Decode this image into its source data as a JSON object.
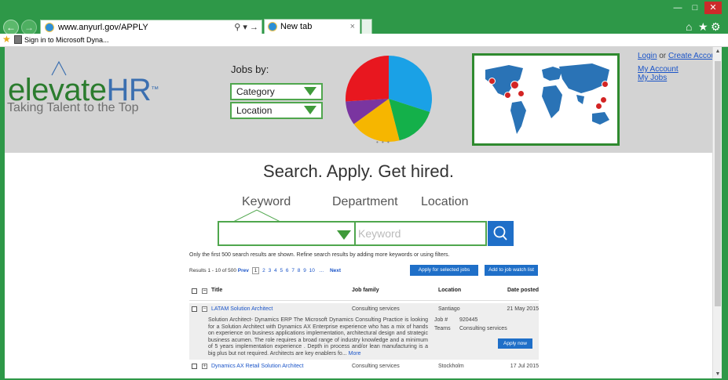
{
  "browser": {
    "url": "www.anyurl.gov/APPLY",
    "tab_title": "New tab",
    "favorite_label": "Sign in to Microsoft Dyna..."
  },
  "header": {
    "logo_word_main": "elevate",
    "logo_word_hr": "HR",
    "logo_tm": "™",
    "logo_tagline": "Taking Talent to the Top",
    "jobs_by_label": "Jobs by:",
    "category_select": "Category",
    "location_select": "Location",
    "account": {
      "login": "Login",
      "or": "or",
      "create_account": "Create Account",
      "my_account": "My Account",
      "my_jobs": "My Jobs"
    },
    "pie_slices": [
      {
        "color": "#1aa1e6",
        "value": 30
      },
      {
        "color": "#14b04a",
        "value": 16
      },
      {
        "color": "#f6b600",
        "value": 19
      },
      {
        "color": "#7a35a0",
        "value": 9
      },
      {
        "color": "#e8171f",
        "value": 26
      }
    ]
  },
  "search": {
    "hero": "Search. Apply. Get hired.",
    "tabs": [
      "Keyword",
      "Department",
      "Location"
    ],
    "keyword_placeholder": "Keyword"
  },
  "results": {
    "note": "Only the first 500 search results are shown. Refine search results by adding more keywords or using filters.",
    "range": "Results 1 - 10 of 500",
    "prev": "Prev",
    "current_page": "1",
    "pages": [
      "2",
      "3",
      "4",
      "5",
      "6",
      "7",
      "8",
      "9",
      "10",
      "..."
    ],
    "next": "Next",
    "apply_selected": "Apply for selected jobs",
    "add_watch": "Add to job watch list",
    "columns": {
      "title": "Title",
      "job_family": "Job family",
      "location": "Location",
      "date_posted": "Date posted"
    },
    "rows": [
      {
        "title": "LATAM Solution Architect",
        "job_family": "Consulting services",
        "location": "Santiago",
        "date": "21 May 2015",
        "description": "Solution Architect- Dynamics ERP The Microsoft Dynamics Consulting Practice is looking for a Solution Architect with Dynamics AX Enterprise experience who has a mix of hands on experience on business applications implementation, architectural design and strategic business acumen. The role requires a broad range of industry knowledge and a minimum of 5 years implementation experience . Depth in process and/or lean manufacturing is a big plus but not required. Architects are key enablers fo...",
        "more": "More",
        "job_label": "Job #",
        "job_number": "920445",
        "teams_label": "Teams",
        "teams_value": "Consulting services",
        "apply_now": "Apply now"
      },
      {
        "title": "Dynamics AX Retail Solution Architect",
        "job_family": "Consulting services",
        "location": "Stockholm",
        "date": "17 Jul 2015"
      }
    ]
  },
  "colors": {
    "chrome_green": "#2e9848",
    "accent_green": "#4fa64d",
    "button_blue": "#1f6fc8",
    "link_blue": "#1a54c8"
  }
}
